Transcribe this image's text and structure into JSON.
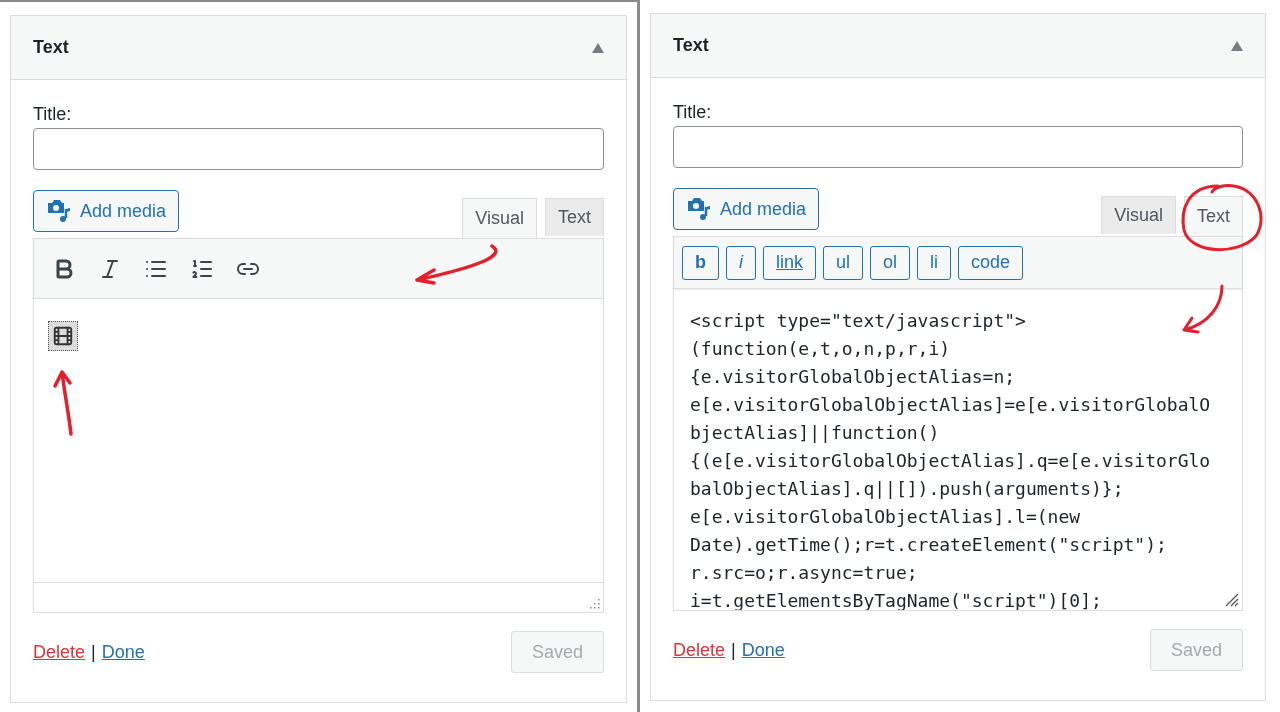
{
  "panels": [
    {
      "title": "Text",
      "title_label": "Title:",
      "add_media": "Add media",
      "tabs": [
        {
          "label": "Visual",
          "selected": true
        },
        {
          "label": "Text",
          "selected": false
        }
      ],
      "editor": {
        "kind": "visual",
        "tools": [
          {
            "kind": "bold"
          },
          {
            "kind": "italic"
          },
          {
            "kind": "bullets"
          },
          {
            "kind": "numbers"
          },
          {
            "kind": "link"
          }
        ],
        "content": [
          {
            "kind": "video"
          }
        ]
      },
      "delete": "Delete",
      "separator": "|",
      "done": "Done",
      "saved": {
        "label": "Saved",
        "disabled": true
      }
    },
    {
      "title": "Text",
      "title_label": "Title:",
      "add_media": "Add media",
      "tabs": [
        {
          "label": "Visual",
          "selected": false
        },
        {
          "label": "Text",
          "selected": true
        }
      ],
      "editor": {
        "kind": "text",
        "tags": [
          {
            "label": "b",
            "kind": "bold"
          },
          {
            "label": "i",
            "kind": "italic"
          },
          {
            "label": "link",
            "kind": "link"
          },
          {
            "label": "ul",
            "kind": "plain"
          },
          {
            "label": "ol",
            "kind": "plain"
          },
          {
            "label": "li",
            "kind": "plain"
          },
          {
            "label": "code",
            "kind": "plain"
          }
        ],
        "code_lines": [
          "<script type=\"text/javascript\">",
          "(function(e,t,o,n,p,r,i)",
          "{e.visitorGlobalObjectAlias=n;",
          "e[e.visitorGlobalObjectAlias]=e[e.visitorGlobalO",
          "bjectAlias]||function()",
          "{(e[e.visitorGlobalObjectAlias].q=e[e.visitorGlo",
          "balObjectAlias].q||[]).push(arguments)};",
          "e[e.visitorGlobalObjectAlias].l=(new",
          "Date).getTime();r=t.createElement(\"script\");",
          "r.src=o;r.async=true;",
          "i=t.getElementsByTagName(\"script\")[0];"
        ]
      },
      "delete": "Delete",
      "separator": "|",
      "done": "Done",
      "saved": {
        "label": "Saved",
        "disabled": true
      }
    }
  ]
}
